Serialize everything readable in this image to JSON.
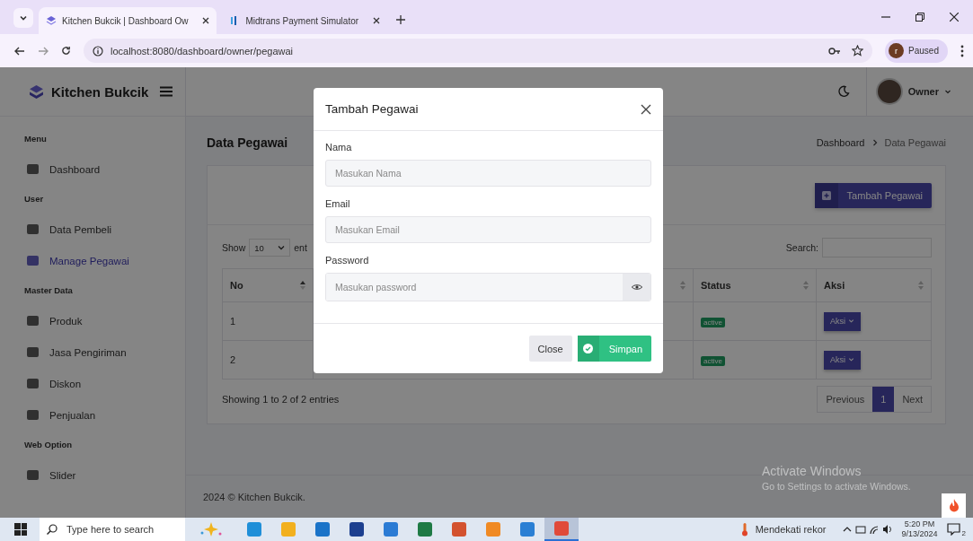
{
  "browser": {
    "tabs": [
      {
        "title": "Kitchen Bukcik | Dashboard Ow",
        "selected": true
      },
      {
        "title": "Midtrans Payment Simulator",
        "selected": false
      }
    ],
    "url": "localhost:8080/dashboard/owner/pegawai",
    "profile": {
      "initial": "r",
      "status": "Paused"
    }
  },
  "sidebar": {
    "brand": "Kitchen Bukcik",
    "items": [
      {
        "kind": "section",
        "label": "Menu"
      },
      {
        "kind": "link",
        "label": "Dashboard",
        "selected": false
      },
      {
        "kind": "section",
        "label": "User"
      },
      {
        "kind": "link",
        "label": "Data Pembeli",
        "selected": false
      },
      {
        "kind": "link",
        "label": "Manage Pegawai",
        "selected": true
      },
      {
        "kind": "section",
        "label": "Master Data"
      },
      {
        "kind": "link",
        "label": "Produk",
        "selected": false
      },
      {
        "kind": "link",
        "label": "Jasa Pengiriman",
        "selected": false
      },
      {
        "kind": "link",
        "label": "Diskon",
        "selected": false
      },
      {
        "kind": "link",
        "label": "Penjualan",
        "selected": false
      },
      {
        "kind": "section",
        "label": "Web Option"
      },
      {
        "kind": "link",
        "label": "Slider",
        "selected": false
      }
    ]
  },
  "header": {
    "user": "Owner"
  },
  "page": {
    "title": "Data Pegawai",
    "breadcrumb": [
      "Dashboard",
      "Data Pegawai"
    ],
    "add_button": "Tambah Pegawai",
    "show_label": "Show",
    "page_length": "10",
    "entries_label": "ent",
    "search_label": "Search:",
    "table": {
      "columns": [
        "No",
        "Status",
        "Aksi"
      ],
      "rows": [
        {
          "no": "1",
          "status": "active",
          "action": "Aksi"
        },
        {
          "no": "2",
          "status": "active",
          "action": "Aksi"
        }
      ]
    },
    "info": "Showing 1 to 2 of 2 entries",
    "pagination": [
      {
        "label": "Previous",
        "selected": false
      },
      {
        "label": "1",
        "selected": true
      },
      {
        "label": "Next",
        "selected": false
      }
    ],
    "footer": "2024 © Kitchen Bukcik."
  },
  "modal": {
    "title": "Tambah Pegawai",
    "fields": [
      {
        "kind": "text",
        "label": "Nama",
        "placeholder": "Masukan Nama"
      },
      {
        "kind": "text",
        "label": "Email",
        "placeholder": "Masukan Email"
      },
      {
        "kind": "password",
        "label": "Password",
        "placeholder": "Masukan password"
      }
    ],
    "buttons": [
      {
        "kind": "secondary",
        "label": "Close"
      },
      {
        "kind": "primary",
        "label": "Simpan"
      }
    ]
  },
  "windows_notice": {
    "title": "Activate Windows",
    "text": "Go to Settings to activate Windows."
  },
  "taskbar": {
    "search_placeholder": "Type here to search",
    "apps": [
      {
        "selected": false
      },
      {
        "selected": false
      },
      {
        "selected": false
      },
      {
        "selected": false
      },
      {
        "selected": false
      },
      {
        "selected": false
      },
      {
        "selected": false
      },
      {
        "selected": false
      },
      {
        "selected": false
      },
      {
        "selected": true
      }
    ],
    "weather": "Mendekati rekor",
    "time": "5:20 PM",
    "date": "9/13/2024",
    "notifications": "2"
  }
}
